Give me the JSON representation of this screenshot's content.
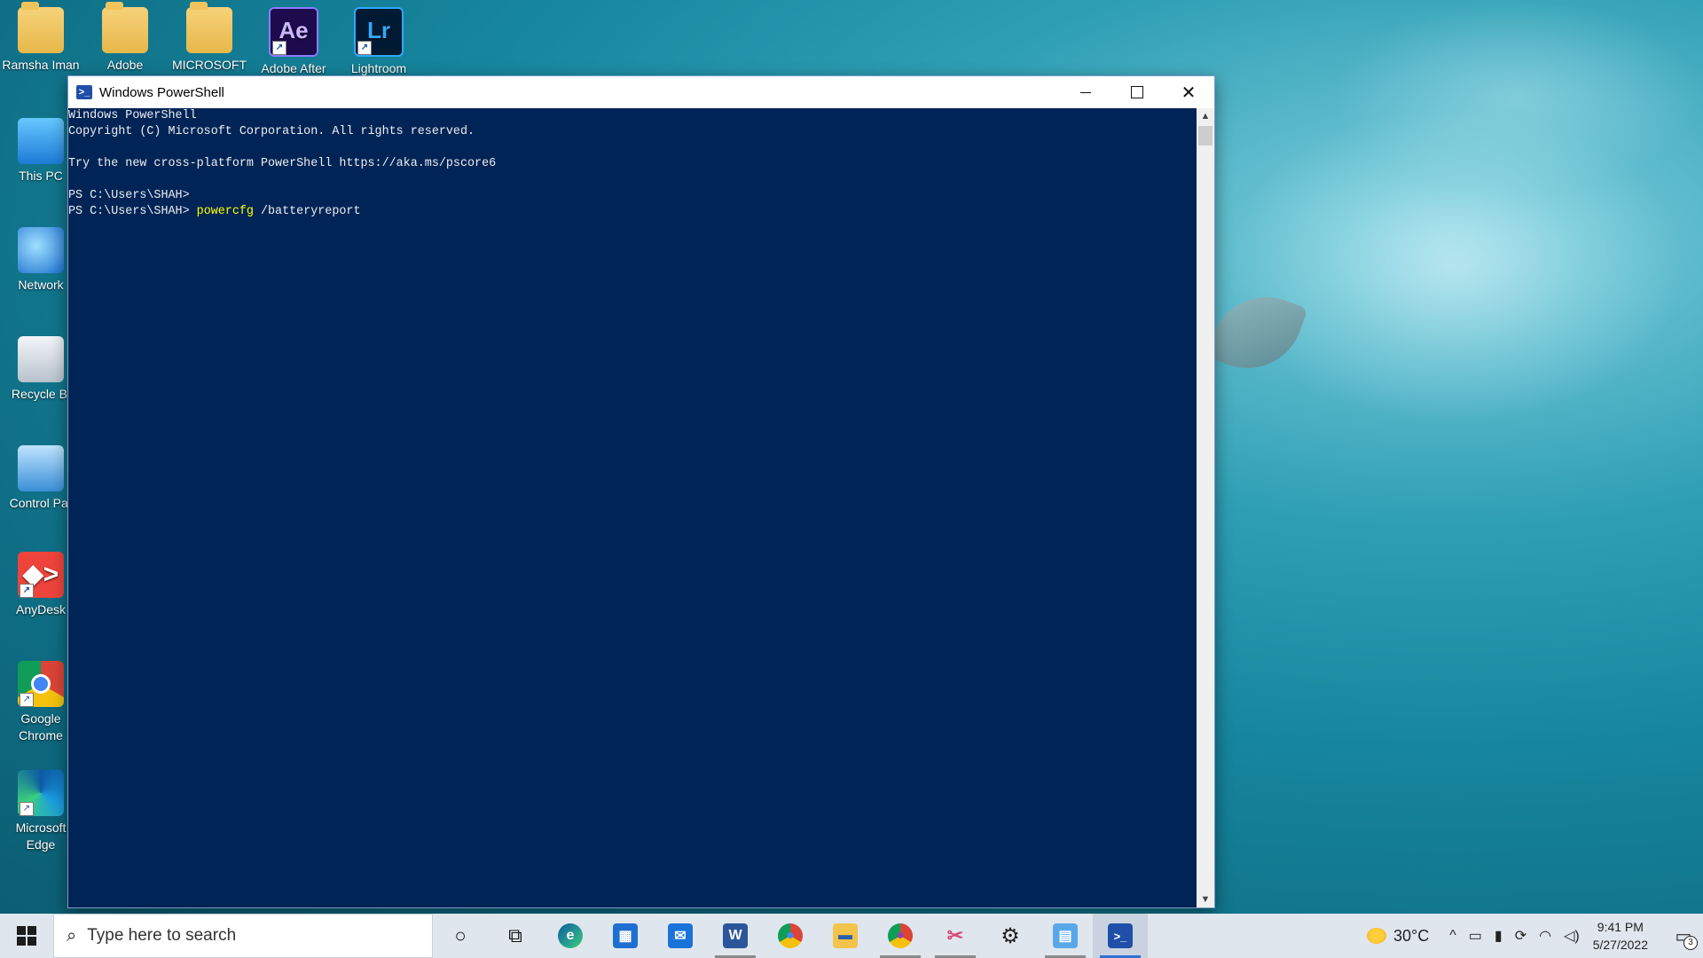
{
  "desktop": {
    "icons": [
      {
        "label": "Ramsha Iman",
        "icon": "folder-user-icon"
      },
      {
        "label": "Adobe",
        "icon": "folder-icon"
      },
      {
        "label": "MICROSOFT",
        "icon": "folder-icon"
      },
      {
        "label": "Adobe After",
        "icon": "after-effects-icon",
        "glyph": "Ae"
      },
      {
        "label": "Lightroom",
        "icon": "lightroom-icon",
        "glyph": "Lr"
      },
      {
        "label": "This PC",
        "icon": "this-pc-icon"
      },
      {
        "label": "Network",
        "icon": "network-icon"
      },
      {
        "label": "Recycle Bi",
        "icon": "recycle-bin-icon"
      },
      {
        "label": "Control Par",
        "icon": "control-panel-icon"
      },
      {
        "label": "AnyDesk",
        "icon": "anydesk-icon",
        "glyph": "◆>"
      },
      {
        "label": "Google\nChrome",
        "icon": "chrome-icon"
      },
      {
        "label": "Microsoft\nEdge",
        "icon": "edge-icon"
      }
    ]
  },
  "window": {
    "title": "Windows PowerShell",
    "app_glyph": ">_",
    "controls": {
      "minimize": "minimize",
      "maximize": "maximize",
      "close": "✕"
    },
    "console": {
      "lines": [
        "Windows PowerShell",
        "Copyright (C) Microsoft Corporation. All rights reserved.",
        "",
        "Try the new cross-platform PowerShell https://aka.ms/pscore6",
        "",
        "PS C:\\Users\\SHAH>"
      ],
      "prompt": "PS C:\\Users\\SHAH> ",
      "command": "powercfg",
      "args": " /batteryreport",
      "background": "#012456",
      "command_color": "#ffff00"
    }
  },
  "taskbar": {
    "search_placeholder": "Type here to search",
    "apps": [
      {
        "name": "cortana",
        "icon": "cortana-icon",
        "glyph": "○"
      },
      {
        "name": "task-view",
        "icon": "task-view-icon",
        "glyph": "⧉"
      },
      {
        "name": "edge",
        "icon": "edge-icon",
        "glyph": "e"
      },
      {
        "name": "store",
        "icon": "store-icon",
        "glyph": "▦"
      },
      {
        "name": "mail",
        "icon": "mail-icon",
        "glyph": "✉"
      },
      {
        "name": "word",
        "icon": "word-icon",
        "glyph": "W"
      },
      {
        "name": "chrome",
        "icon": "chrome-icon",
        "glyph": "●"
      },
      {
        "name": "file-explorer",
        "icon": "file-explorer-icon",
        "glyph": "▬"
      },
      {
        "name": "chrome-profile",
        "icon": "chrome-profile-icon",
        "glyph": "●"
      },
      {
        "name": "snip",
        "icon": "snipping-tool-icon",
        "glyph": "✂"
      },
      {
        "name": "settings",
        "icon": "settings-icon",
        "glyph": "⚙"
      },
      {
        "name": "control-panel",
        "icon": "control-panel-icon",
        "glyph": "▤"
      },
      {
        "name": "powershell",
        "icon": "powershell-icon",
        "glyph": ">_"
      }
    ],
    "weather": "30°C",
    "tray_icons": [
      "^",
      "▭",
      "▮",
      "⟳",
      "◠",
      "◁)"
    ],
    "time": "9:41 PM",
    "date": "5/27/2022",
    "notification_count": "3"
  }
}
